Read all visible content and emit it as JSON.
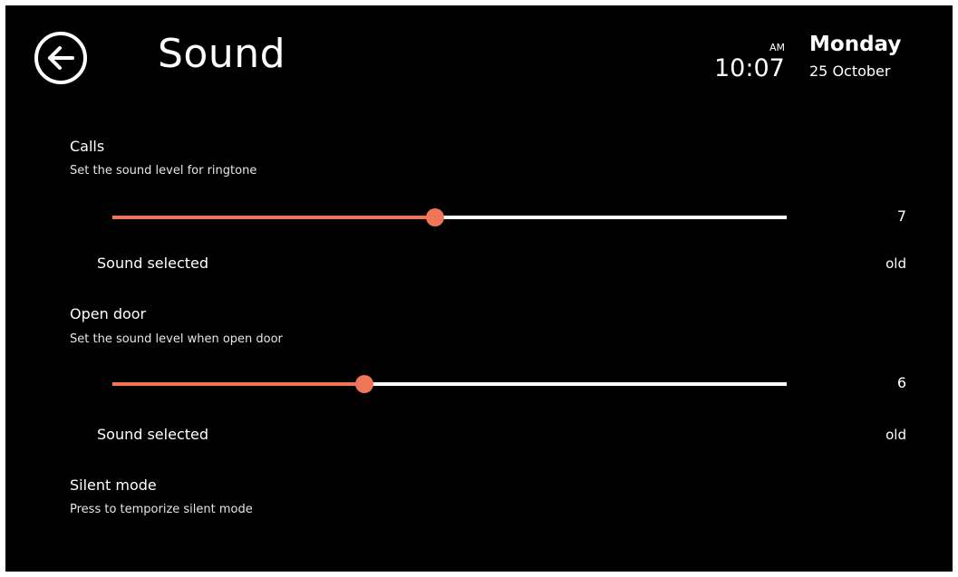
{
  "header": {
    "title": "Sound",
    "ampm": "AM",
    "time": "10:07",
    "day": "Monday",
    "date": "25 October",
    "back_icon": "back-arrow-circle-icon"
  },
  "colors": {
    "accent": "#ef7656",
    "background": "#000000",
    "text": "#ffffff"
  },
  "calls": {
    "title": "Calls",
    "subtitle": "Set the sound level for ringtone",
    "level": "7",
    "fill_fraction": 0.479,
    "sound_label": "Sound selected",
    "sound_value": "old"
  },
  "open_door": {
    "title": "Open door",
    "subtitle": "Set the sound level when open door",
    "level": "6",
    "fill_fraction": 0.374,
    "sound_label": "Sound selected",
    "sound_value": "old"
  },
  "silent_mode": {
    "title": "Silent mode",
    "subtitle": "Press to temporize silent mode"
  }
}
